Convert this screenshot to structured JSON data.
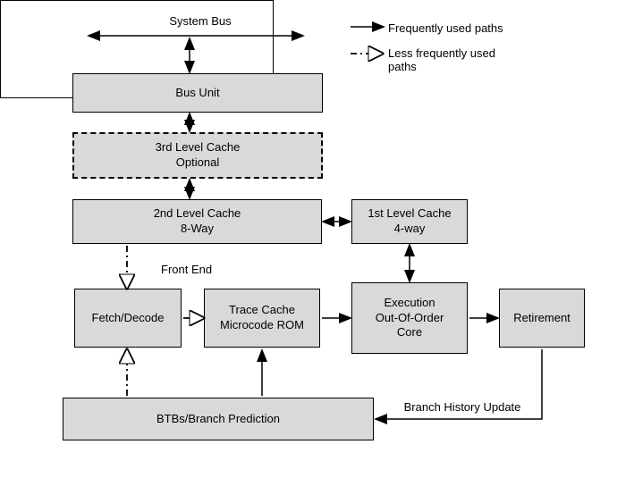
{
  "legend": {
    "freq": "Frequently used paths",
    "less_freq": "Less frequently used paths"
  },
  "labels": {
    "system_bus": "System Bus",
    "front_end": "Front End",
    "branch_history": "Branch History Update"
  },
  "blocks": {
    "bus_unit": "Bus Unit",
    "l3_cache_line1": "3rd Level  Cache",
    "l3_cache_line2": "Optional",
    "l2_cache_line1": "2nd Level Cache",
    "l2_cache_line2": "8-Way",
    "l1_cache_line1": "1st Level Cache",
    "l1_cache_line2": "4-way",
    "fetch_decode": "Fetch/Decode",
    "trace_cache_line1": "Trace Cache",
    "trace_cache_line2": "Microcode ROM",
    "exec_line1": "Execution",
    "exec_line2": "Out-Of-Order",
    "exec_line3": "Core",
    "retirement": "Retirement",
    "btb": "BTBs/Branch Prediction"
  }
}
